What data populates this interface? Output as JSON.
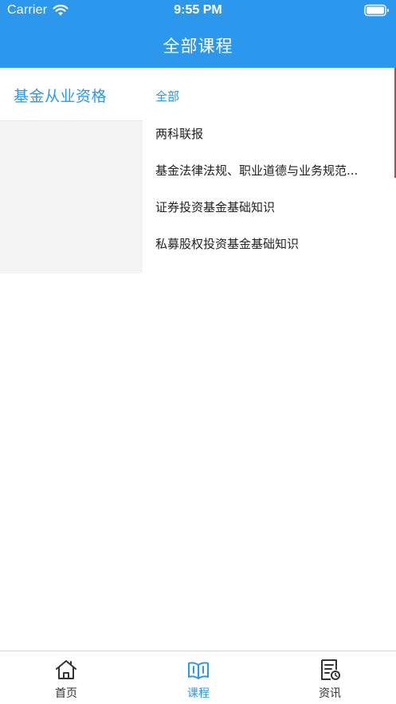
{
  "status_bar": {
    "carrier": "Carrier",
    "time": "9:55 PM"
  },
  "header": {
    "title": "全部课程",
    "background_color": "#2b98ee"
  },
  "categories": [
    {
      "label": "基金从业资格",
      "selected": true
    }
  ],
  "courses": [
    {
      "label": "全部",
      "selected": true
    },
    {
      "label": "两科联报",
      "selected": false
    },
    {
      "label": "基金法律法规、职业道德与业务规范...",
      "selected": false
    },
    {
      "label": "证券投资基金基础知识",
      "selected": false
    },
    {
      "label": "私募股权投资基金基础知识",
      "selected": false
    }
  ],
  "tabbar": {
    "tabs": [
      {
        "label": "首页",
        "icon": "home-icon",
        "selected": false
      },
      {
        "label": "课程",
        "icon": "open-book-icon",
        "selected": true
      },
      {
        "label": "资讯",
        "icon": "news-document-icon",
        "selected": false
      }
    ],
    "accent_color": "#2b98ee"
  }
}
